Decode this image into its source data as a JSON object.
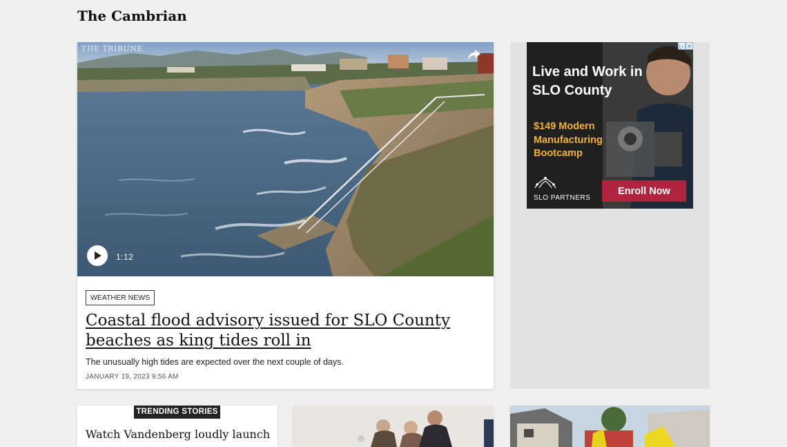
{
  "site": {
    "title": "The Cambrian"
  },
  "hero": {
    "watermark": "THE TRIBUNE",
    "video_duration": "1:12",
    "tag": "WEATHER NEWS",
    "headline": "Coastal flood advisory issued for SLO County beaches as king tides roll in",
    "summary": "The unusually high tides are expected over the next couple of days.",
    "dateline": "JANUARY 19, 2023 9:56 AM",
    "icons": {
      "share": "share-arrow-icon",
      "play": "play-icon"
    }
  },
  "ad": {
    "headline": "Live and Work in SLO County",
    "offer": "$149 Modern Manufacturing Bootcamp",
    "brand": "SLO PARTNERS",
    "cta_label": "Enroll Now",
    "colors": {
      "offer": "#f2b33d",
      "cta": "#b0243f"
    }
  },
  "trending": {
    "label": "TRENDING STORIES",
    "first_headline": "Watch Vandenberg loudly launch"
  }
}
